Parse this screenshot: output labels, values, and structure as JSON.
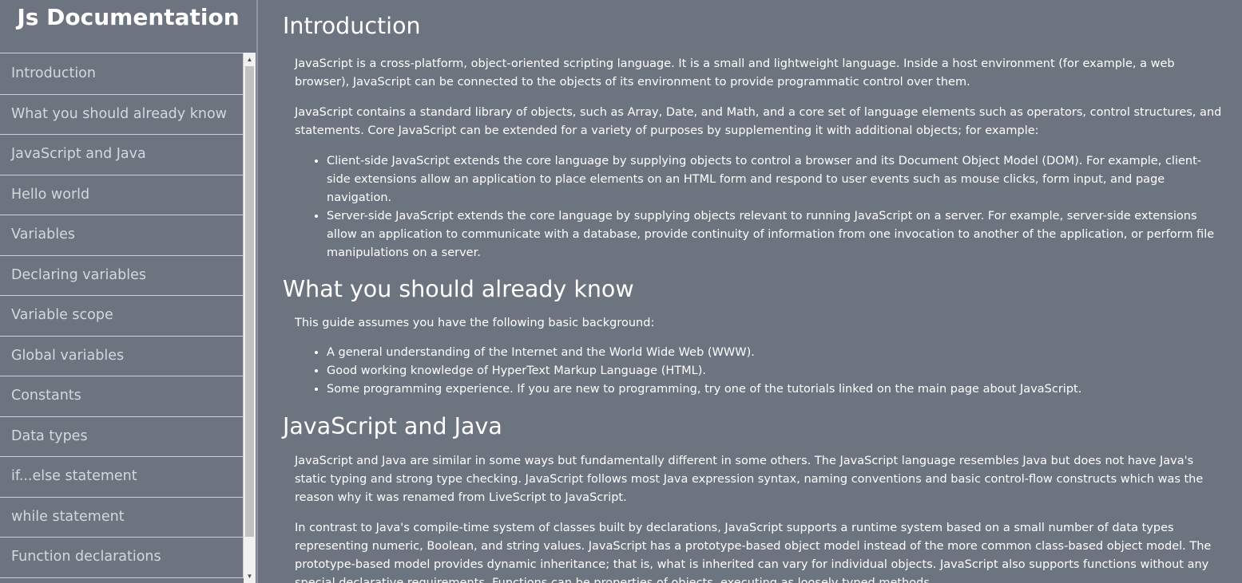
{
  "navbar": {
    "title": "Js Documentation",
    "items": [
      "Introduction",
      "What you should already know",
      "JavaScript and Java",
      "Hello world",
      "Variables",
      "Declaring variables",
      "Variable scope",
      "Global variables",
      "Constants",
      "Data types",
      "if...else statement",
      "while statement",
      "Function declarations"
    ]
  },
  "scrollbar": {
    "up_icon": "▲",
    "down_icon": "▼"
  },
  "sections": {
    "introduction": {
      "title": "Introduction",
      "p1": "JavaScript is a cross-platform, object-oriented scripting language. It is a small and lightweight language. Inside a host environment (for example, a web browser), JavaScript can be connected to the objects of its environment to provide programmatic control over them.",
      "p2": "JavaScript contains a standard library of objects, such as Array, Date, and Math, and a core set of language elements such as operators, control structures, and statements. Core JavaScript can be extended for a variety of purposes by supplementing it with additional objects; for example:",
      "list": [
        "Client-side JavaScript extends the core language by supplying objects to control a browser and its Document Object Model (DOM). For example, client-side extensions allow an application to place elements on an HTML form and respond to user events such as mouse clicks, form input, and page navigation.",
        "Server-side JavaScript extends the core language by supplying objects relevant to running JavaScript on a server. For example, server-side extensions allow an application to communicate with a database, provide continuity of information from one invocation to another of the application, or perform file manipulations on a server."
      ]
    },
    "know": {
      "title": "What you should already know",
      "p1": "This guide assumes you have the following basic background:",
      "list": [
        "A general understanding of the Internet and the World Wide Web (WWW).",
        "Good working knowledge of HyperText Markup Language (HTML).",
        "Some programming experience. If you are new to programming, try one of the tutorials linked on the main page about JavaScript."
      ]
    },
    "java": {
      "title": "JavaScript and Java",
      "p1": "JavaScript and Java are similar in some ways but fundamentally different in some others. The JavaScript language resembles Java but does not have Java's static typing and strong type checking. JavaScript follows most Java expression syntax, naming conventions and basic control-flow constructs which was the reason why it was renamed from LiveScript to JavaScript.",
      "p2": "In contrast to Java's compile-time system of classes built by declarations, JavaScript supports a runtime system based on a small number of data types representing numeric, Boolean, and string values. JavaScript has a prototype-based object model instead of the more common class-based object model. The prototype-based model provides dynamic inheritance; that is, what is inherited can vary for individual objects. JavaScript also supports functions without any special declarative requirements. Functions can be properties of objects, executing as loosely typed methods."
    }
  }
}
